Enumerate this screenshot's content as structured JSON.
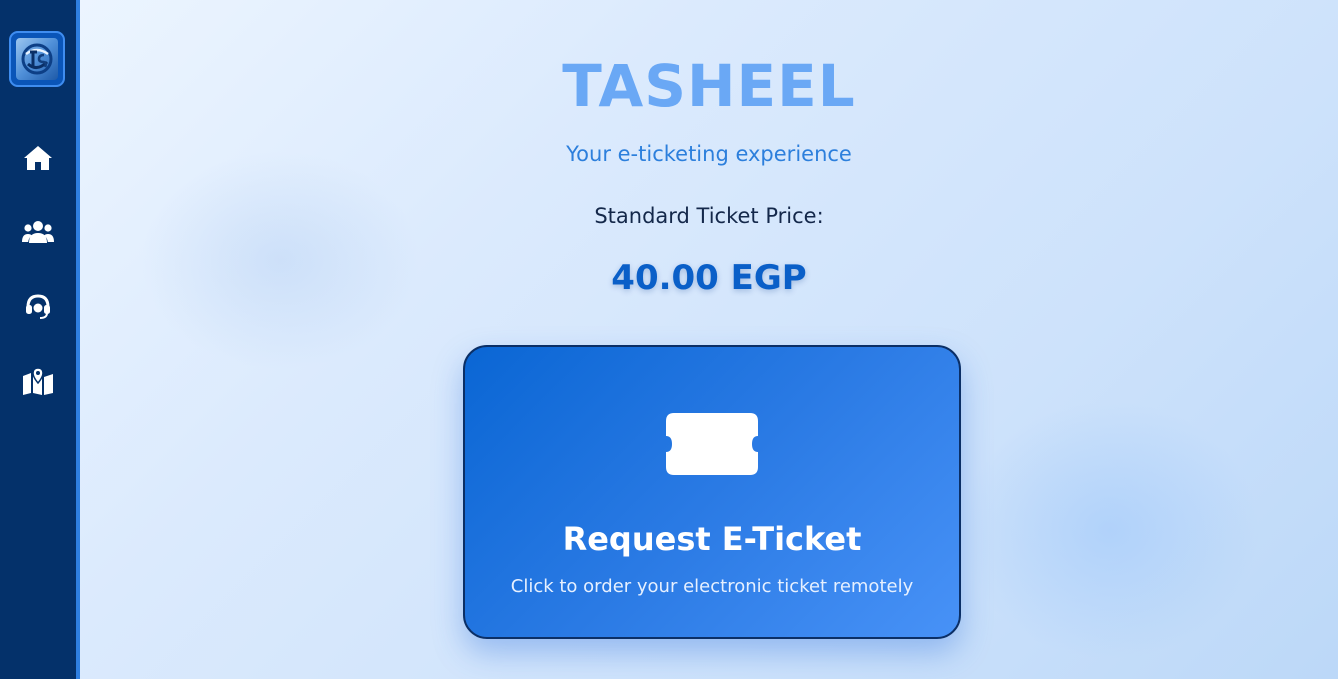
{
  "sidebar": {
    "logo_icon": "tasheel-logo-icon",
    "items": [
      {
        "name": "home",
        "icon": "home-icon"
      },
      {
        "name": "users",
        "icon": "users-icon"
      },
      {
        "name": "support",
        "icon": "headset-icon"
      },
      {
        "name": "map",
        "icon": "map-icon"
      }
    ]
  },
  "header": {
    "title": "TASHEEL",
    "subtitle": "Your e-ticketing experience"
  },
  "pricing": {
    "label": "Standard Ticket Price:",
    "value": "40.00 EGP"
  },
  "ticket_card": {
    "icon": "ticket-icon",
    "title": "Request E-Ticket",
    "description": "Click to order your electronic ticket remotely"
  },
  "colors": {
    "sidebar_bg": "#04316a",
    "accent": "#2f7fe0",
    "brand_title": "#6aa8f5",
    "price": "#0a5fc8",
    "card_start": "#0a66d4",
    "card_end": "#4892f7"
  }
}
